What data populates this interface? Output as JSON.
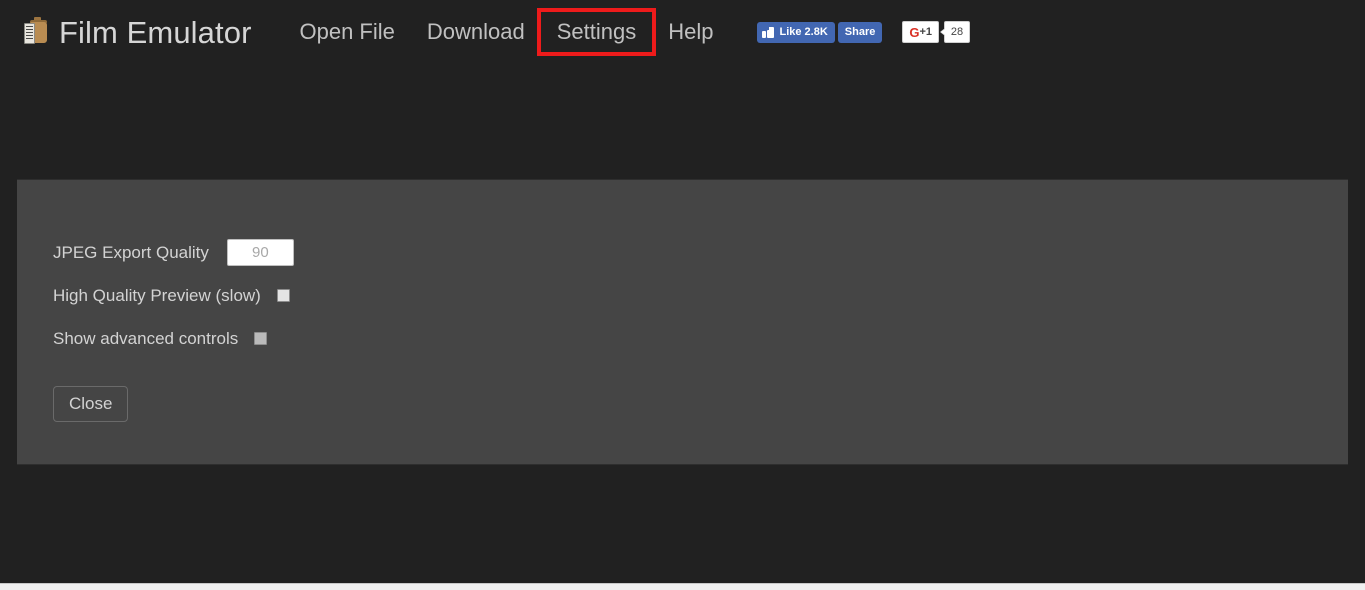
{
  "app": {
    "title": "Film Emulator",
    "logo_icon": "film-canister-icon"
  },
  "nav": {
    "items": [
      {
        "label": "Open File",
        "name": "open-file",
        "highlighted": false
      },
      {
        "label": "Download",
        "name": "download",
        "highlighted": false
      },
      {
        "label": "Settings",
        "name": "settings",
        "highlighted": true
      },
      {
        "label": "Help",
        "name": "help",
        "highlighted": false
      }
    ],
    "highlight_color": "#ee1b1b"
  },
  "social": {
    "facebook": {
      "like_label": "Like 2.8K",
      "share_label": "Share",
      "icon": "thumbs-up-icon",
      "color": "#4267b2"
    },
    "googleplus": {
      "g_label": "G",
      "plus_label": "+1",
      "count": "28",
      "g_color": "#d93025"
    }
  },
  "settings_panel": {
    "background": "#454545",
    "rows": [
      {
        "label": "JPEG Export Quality",
        "control": "text-input",
        "name": "jpeg-export-quality",
        "value": "90",
        "placeholder": "90"
      },
      {
        "label": "High Quality Preview (slow)",
        "control": "checkbox",
        "name": "high-quality-preview",
        "checked": false
      },
      {
        "label": "Show advanced controls",
        "control": "checkbox",
        "name": "show-advanced-controls",
        "checked": false
      }
    ],
    "close_label": "Close"
  },
  "page": {
    "background": "#212121"
  }
}
